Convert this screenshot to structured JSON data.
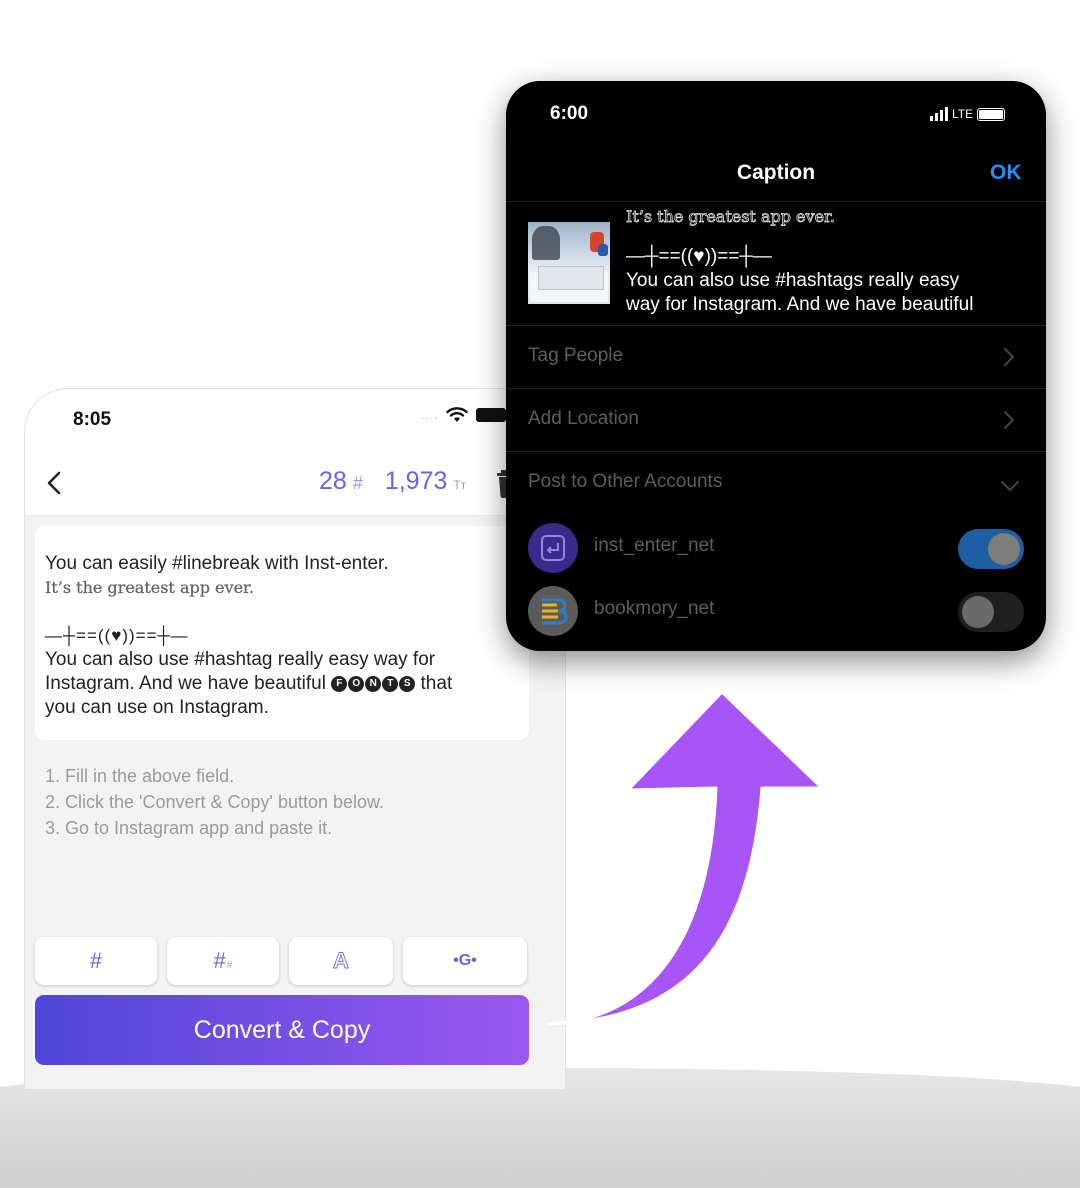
{
  "editor_phone": {
    "status_time": "8:05",
    "status_dots": "....",
    "hashtag_count": "28",
    "hashtag_symbol": "#",
    "char_count": "1,973",
    "char_symbol": "Tт",
    "text": {
      "line1": "You can easily #linebreak with Inst-enter.",
      "line2": "It’s the greatest app ever.",
      "line3": "—┼==((♥))==┼—",
      "line4": "You can also use #hashtag really easy way for",
      "line5a": "Instagram. And we have beautiful",
      "fonts_letters": [
        "F",
        "O",
        "N",
        "T",
        "S"
      ],
      "line5b": "that",
      "line6": "you can use on Instagram."
    },
    "instructions": [
      "1. Fill in the above field.",
      "2. Click the 'Convert & Copy' button below.",
      "3. Go to Instagram app and paste it."
    ],
    "tools": {
      "hashtag": "#",
      "hashtag_sub_main": "#",
      "hashtag_sub_small": "#",
      "font": "A",
      "more": "•G•"
    },
    "convert_button": "Convert & Copy"
  },
  "caption_phone": {
    "status_time": "6:00",
    "network": "LTE",
    "title": "Caption",
    "ok": "OK",
    "caption": {
      "line1": "It’s the greatest app ever.",
      "line2": "—┼==((♥))==┼—",
      "line3": "You can also use #hashtags really easy",
      "line4": "way for Instagram. And we have beautiful"
    },
    "rows": {
      "tag_people": "Tag People",
      "add_location": "Add Location",
      "post_other": "Post to Other Accounts"
    },
    "accounts": [
      {
        "name": "inst_enter_net",
        "enabled": true
      },
      {
        "name": "bookmory_net",
        "enabled": false
      }
    ]
  },
  "colors": {
    "accent_purple": "#6b63e6",
    "button_gradient_start": "#4f46d9",
    "button_gradient_end": "#9b58ee",
    "ok_blue": "#2c8cf5",
    "arrow_purple": "#a855f7",
    "toggle_on": "#1d5fa0"
  },
  "icons": {
    "back": "chevron-left-icon",
    "trash": "trash-icon",
    "wifi": "wifi-icon",
    "battery": "battery-icon",
    "signal": "signal-icon",
    "chevron_right": "chevron-right-icon",
    "chevron_down": "chevron-down-icon",
    "arrow": "curved-arrow-icon"
  }
}
